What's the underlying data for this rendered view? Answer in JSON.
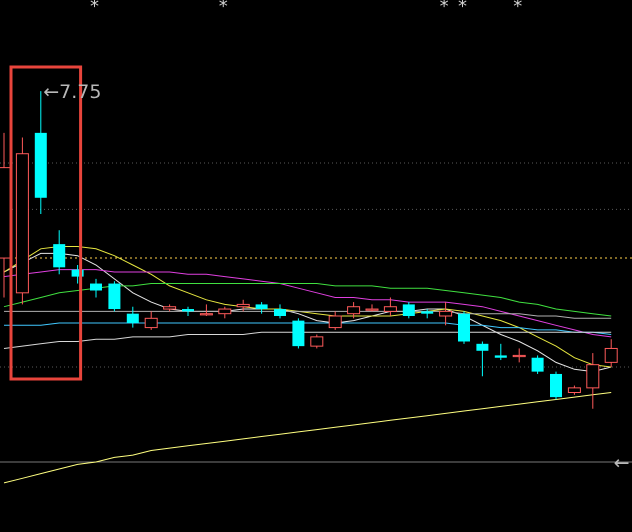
{
  "chart_data": {
    "type": "candlestick",
    "title": "",
    "xlabel": "",
    "ylabel": "",
    "ylim": [
      5.9,
      8.1
    ],
    "annotations": [
      {
        "text": "←7.75",
        "x": 3,
        "y": 7.75
      },
      {
        "text": "←",
        "x": 34,
        "y": 6.15
      }
    ],
    "markers": [
      {
        "text": "*",
        "x": 5
      },
      {
        "text": "*",
        "x": 12
      },
      {
        "text": "*",
        "x": 24
      },
      {
        "text": "*",
        "x": 25
      },
      {
        "text": "*",
        "x": 28
      }
    ],
    "highlight": {
      "x_range": [
        0,
        4
      ],
      "color": "#e8453c"
    },
    "reference_lines": [
      {
        "y": 7.03,
        "style": "dotted",
        "color": "#ffd24d"
      },
      {
        "y": 6.15,
        "style": "solid",
        "color": "#777777"
      }
    ],
    "candles": [
      {
        "open": 7.03,
        "close": 7.42,
        "high": 7.57,
        "low": 6.86
      },
      {
        "open": 6.88,
        "close": 7.48,
        "high": 7.55,
        "low": 6.83
      },
      {
        "open": 7.57,
        "close": 7.29,
        "high": 7.75,
        "low": 7.22
      },
      {
        "open": 7.09,
        "close": 6.99,
        "high": 7.15,
        "low": 6.96
      },
      {
        "open": 6.98,
        "close": 6.95,
        "high": 7.0,
        "low": 6.92
      },
      {
        "open": 6.92,
        "close": 6.89,
        "high": 6.94,
        "low": 6.86
      },
      {
        "open": 6.92,
        "close": 6.81,
        "high": 6.93,
        "low": 6.8
      },
      {
        "open": 6.79,
        "close": 6.75,
        "high": 6.82,
        "low": 6.73
      },
      {
        "open": 6.73,
        "close": 6.77,
        "high": 6.8,
        "low": 6.72
      },
      {
        "open": 6.81,
        "close": 6.82,
        "high": 6.83,
        "low": 6.8
      },
      {
        "open": 6.81,
        "close": 6.8,
        "high": 6.82,
        "low": 6.78
      },
      {
        "open": 6.79,
        "close": 6.79,
        "high": 6.83,
        "low": 6.78
      },
      {
        "open": 6.79,
        "close": 6.81,
        "high": 6.82,
        "low": 6.77
      },
      {
        "open": 6.82,
        "close": 6.83,
        "high": 6.85,
        "low": 6.8
      },
      {
        "open": 6.83,
        "close": 6.81,
        "high": 6.84,
        "low": 6.79
      },
      {
        "open": 6.81,
        "close": 6.78,
        "high": 6.83,
        "low": 6.77
      },
      {
        "open": 6.76,
        "close": 6.65,
        "high": 6.77,
        "low": 6.64
      },
      {
        "open": 6.65,
        "close": 6.69,
        "high": 6.7,
        "low": 6.64
      },
      {
        "open": 6.73,
        "close": 6.78,
        "high": 6.8,
        "low": 6.72
      },
      {
        "open": 6.79,
        "close": 6.82,
        "high": 6.84,
        "low": 6.77
      },
      {
        "open": 6.81,
        "close": 6.81,
        "high": 6.83,
        "low": 6.8
      },
      {
        "open": 6.8,
        "close": 6.82,
        "high": 6.86,
        "low": 6.78
      },
      {
        "open": 6.83,
        "close": 6.78,
        "high": 6.84,
        "low": 6.77
      },
      {
        "open": 6.8,
        "close": 6.79,
        "high": 6.81,
        "low": 6.77
      },
      {
        "open": 6.78,
        "close": 6.8,
        "high": 6.84,
        "low": 6.74
      },
      {
        "open": 6.79,
        "close": 6.67,
        "high": 6.8,
        "low": 6.66
      },
      {
        "open": 6.66,
        "close": 6.63,
        "high": 6.67,
        "low": 6.52
      },
      {
        "open": 6.61,
        "close": 6.6,
        "high": 6.66,
        "low": 6.59
      },
      {
        "open": 6.61,
        "close": 6.61,
        "high": 6.64,
        "low": 6.58
      },
      {
        "open": 6.6,
        "close": 6.54,
        "high": 6.61,
        "low": 6.53
      },
      {
        "open": 6.53,
        "close": 6.43,
        "high": 6.54,
        "low": 6.42
      },
      {
        "open": 6.45,
        "close": 6.47,
        "high": 6.48,
        "low": 6.44
      },
      {
        "open": 6.47,
        "close": 6.57,
        "high": 6.62,
        "low": 6.38
      },
      {
        "open": 6.58,
        "close": 6.64,
        "high": 6.68,
        "low": 6.56
      }
    ],
    "series": [
      {
        "color": "#e6e6e6",
        "values": [
          6.97,
          7.01,
          7.05,
          7.05,
          7.04,
          7.0,
          6.94,
          6.88,
          6.84,
          6.81,
          6.8,
          6.8,
          6.8,
          6.81,
          6.81,
          6.81,
          6.79,
          6.76,
          6.75,
          6.76,
          6.78,
          6.8,
          6.8,
          6.81,
          6.81,
          6.78,
          6.74,
          6.7,
          6.67,
          6.63,
          6.58,
          6.55,
          6.54,
          6.56
        ]
      },
      {
        "color": "#e6e640",
        "values": [
          6.97,
          7.02,
          7.07,
          7.08,
          7.08,
          7.07,
          7.04,
          7.0,
          6.96,
          6.91,
          6.88,
          6.85,
          6.83,
          6.82,
          6.81,
          6.81,
          6.8,
          6.79,
          6.78,
          6.78,
          6.78,
          6.78,
          6.79,
          6.8,
          6.81,
          6.8,
          6.78,
          6.76,
          6.73,
          6.69,
          6.65,
          6.6,
          6.57,
          6.56
        ]
      },
      {
        "color": "#e040e0",
        "values": [
          6.95,
          6.96,
          6.97,
          6.98,
          6.98,
          6.98,
          6.97,
          6.97,
          6.97,
          6.97,
          6.96,
          6.96,
          6.95,
          6.94,
          6.93,
          6.92,
          6.9,
          6.88,
          6.86,
          6.86,
          6.85,
          6.85,
          6.84,
          6.84,
          6.84,
          6.83,
          6.82,
          6.8,
          6.78,
          6.76,
          6.74,
          6.72,
          6.7,
          6.69
        ]
      },
      {
        "color": "#40e040",
        "values": [
          6.82,
          6.84,
          6.86,
          6.88,
          6.89,
          6.9,
          6.91,
          6.91,
          6.92,
          6.92,
          6.92,
          6.92,
          6.92,
          6.92,
          6.92,
          6.92,
          6.92,
          6.92,
          6.91,
          6.91,
          6.91,
          6.9,
          6.9,
          6.9,
          6.89,
          6.88,
          6.87,
          6.86,
          6.84,
          6.83,
          6.81,
          6.8,
          6.79,
          6.78
        ]
      },
      {
        "color": "#b0b0b0",
        "values": [
          6.8,
          6.8,
          6.8,
          6.8,
          6.8,
          6.8,
          6.8,
          6.8,
          6.8,
          6.8,
          6.8,
          6.8,
          6.8,
          6.8,
          6.8,
          6.8,
          6.8,
          6.8,
          6.8,
          6.8,
          6.8,
          6.8,
          6.8,
          6.8,
          6.8,
          6.79,
          6.79,
          6.79,
          6.79,
          6.78,
          6.78,
          6.77,
          6.77,
          6.77
        ]
      },
      {
        "color": "#40c8ff",
        "values": [
          6.74,
          6.74,
          6.74,
          6.75,
          6.75,
          6.75,
          6.75,
          6.75,
          6.75,
          6.75,
          6.75,
          6.75,
          6.75,
          6.75,
          6.75,
          6.75,
          6.75,
          6.75,
          6.75,
          6.75,
          6.75,
          6.75,
          6.75,
          6.75,
          6.75,
          6.74,
          6.74,
          6.73,
          6.73,
          6.72,
          6.72,
          6.71,
          6.71,
          6.7
        ]
      },
      {
        "color": "#d8d8d8",
        "values": [
          6.64,
          6.65,
          6.66,
          6.67,
          6.67,
          6.68,
          6.68,
          6.69,
          6.69,
          6.69,
          6.7,
          6.7,
          6.7,
          6.7,
          6.71,
          6.71,
          6.71,
          6.71,
          6.71,
          6.71,
          6.71,
          6.71,
          6.71,
          6.71,
          6.71,
          6.71,
          6.71,
          6.71,
          6.71,
          6.71,
          6.71,
          6.71,
          6.71,
          6.71
        ]
      },
      {
        "color": "#ffff80",
        "values": [
          6.06,
          6.08,
          6.1,
          6.12,
          6.14,
          6.15,
          6.17,
          6.18,
          6.2,
          6.21,
          6.22,
          6.23,
          6.24,
          6.25,
          6.26,
          6.27,
          6.28,
          6.29,
          6.3,
          6.31,
          6.32,
          6.33,
          6.34,
          6.35,
          6.36,
          6.37,
          6.38,
          6.39,
          6.4,
          6.41,
          6.42,
          6.43,
          6.44,
          6.45
        ]
      }
    ],
    "gridlines": [
      7.44,
      7.24,
      6.56
    ],
    "grid": true,
    "legend": "none"
  }
}
